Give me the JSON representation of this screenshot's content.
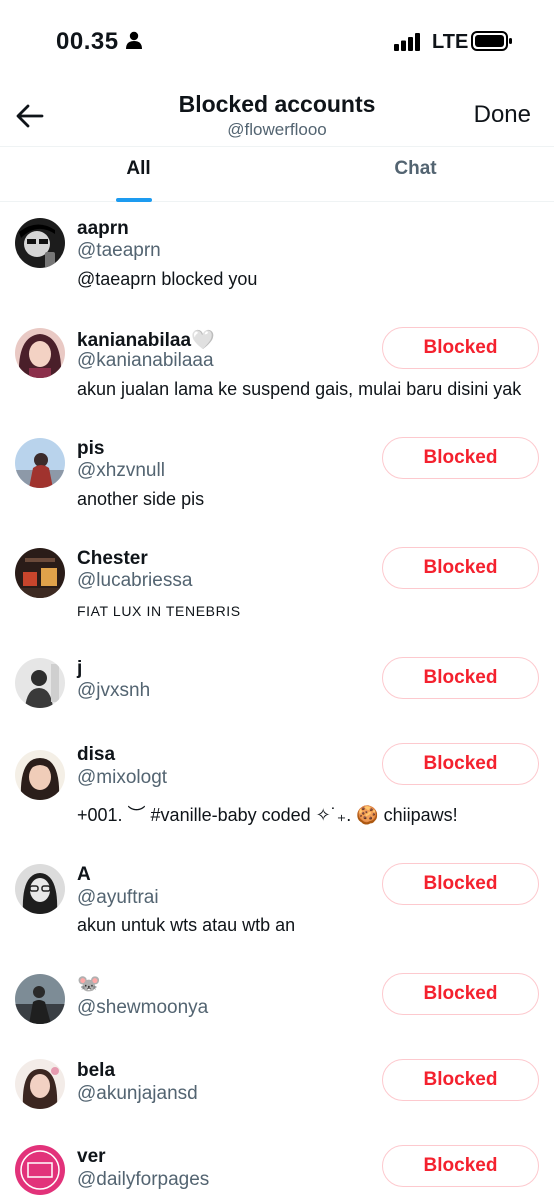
{
  "status_bar": {
    "time": "00.35",
    "network": "LTE"
  },
  "header": {
    "title": "Blocked accounts",
    "subtitle": "@flowerflooo",
    "done_label": "Done"
  },
  "tabs": [
    {
      "label": "All"
    },
    {
      "label": "Chat"
    }
  ],
  "accounts": [
    {
      "name": "aaprn",
      "handle": "@taeaprn",
      "bio": "@taeaprn blocked you",
      "button": ""
    },
    {
      "name": "kanianabilaa🤍",
      "handle": "@kanianabilaaa",
      "bio": "akun jualan lama ke suspend gais, mulai baru disini yak",
      "button": "Blocked"
    },
    {
      "name": "pis",
      "handle": "@xhzvnull",
      "bio": "another side pis",
      "button": "Blocked"
    },
    {
      "name": "Chester",
      "handle": "@lucabriessa",
      "bio": "FIAT LUX IN TENEBRIS",
      "button": "Blocked"
    },
    {
      "name": "j",
      "handle": "@jvxsnh",
      "bio": "",
      "button": "Blocked"
    },
    {
      "name": "disa",
      "handle": "@mixologt",
      "bio": "+001. ︶ #vanille-baby coded ✧˙₊. 🍪 chiipaws!",
      "button": "Blocked"
    },
    {
      "name": "A",
      "handle": "@ayuftrai",
      "bio": "akun untuk wts atau wtb an",
      "button": "Blocked"
    },
    {
      "name": "🐭",
      "handle": "@shewmoonya",
      "bio": "",
      "button": "Blocked"
    },
    {
      "name": "bela",
      "handle": "@akunjajansd",
      "bio": "",
      "button": "Blocked"
    },
    {
      "name": "ver",
      "handle": "@dailyforpages",
      "bio": "",
      "button": "Blocked"
    }
  ],
  "colors": {
    "accent": "#1d9bf0",
    "blocked_red": "#f4212e",
    "muted_text": "#536471"
  }
}
